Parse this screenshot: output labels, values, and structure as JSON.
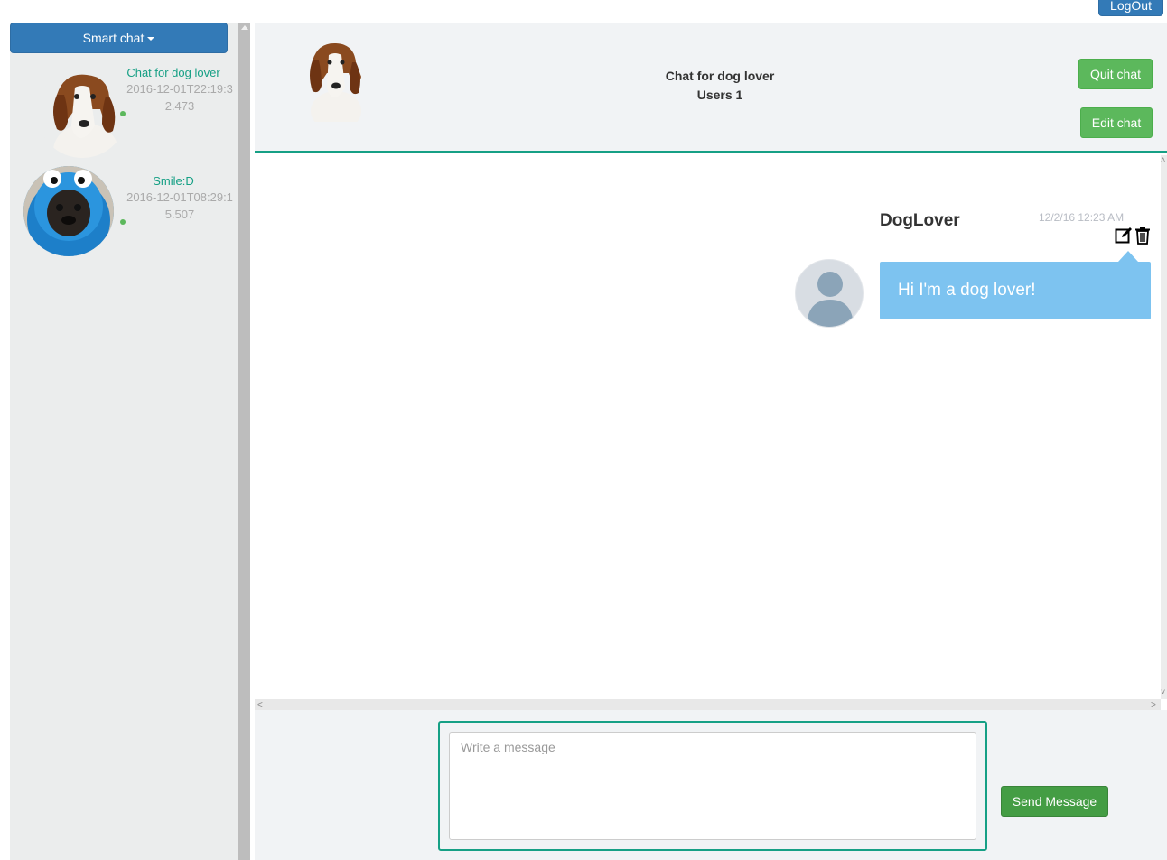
{
  "header": {
    "logout_label": "LogOut"
  },
  "sidebar": {
    "app_menu_label": "Smart chat",
    "chats": [
      {
        "name": "Chat for dog lover",
        "date": "2016-12-01T22:19:32.473",
        "status": "online",
        "avatar": "beagle-avatar"
      },
      {
        "name": "Smile:D",
        "date": "2016-12-01T08:29:15.507",
        "status": "online",
        "avatar": "cookie-monster-pug-avatar"
      }
    ]
  },
  "chat": {
    "title": "Chat for dog lover",
    "users_label": "Users 1",
    "quit_label": "Quit chat",
    "edit_label": "Edit chat",
    "messages": [
      {
        "user": "DogLover",
        "time": "12/2/16 12:23 AM",
        "text": "Hi I'm a dog lover!"
      }
    ]
  },
  "composer": {
    "placeholder": "Write a message",
    "value": "",
    "send_label": "Send Message"
  },
  "colors": {
    "primary": "#337ab7",
    "success": "#5cb85c",
    "accent": "#16a085",
    "bubble": "#7dc3f0",
    "online": "#5cb85c"
  },
  "icons": [
    "caret-down-icon",
    "edit-icon",
    "trash-icon",
    "user-silhouette-icon"
  ]
}
